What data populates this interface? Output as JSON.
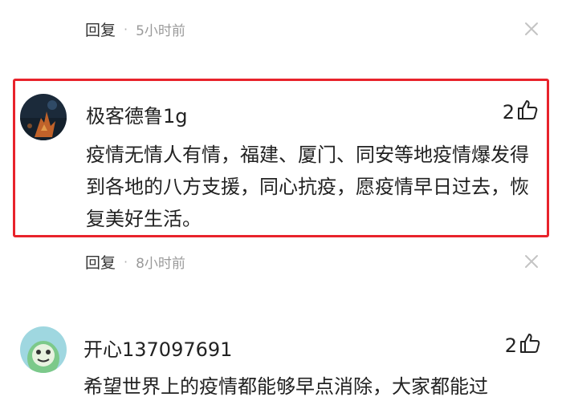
{
  "top_meta": {
    "reply_label": "回复",
    "separator": "·",
    "time": "5小时前"
  },
  "comments": [
    {
      "username": "极客德鲁1g",
      "likes": "2",
      "text": "疫情无情人有情，福建、厦门、同安等地疫情爆发得到各地的八方支援，同心抗疫，愿疫情早日过去，恢复美好生活。",
      "reply_label": "回复",
      "separator": "·",
      "time": "8小时前",
      "highlighted": true,
      "avatar_icon": "dark-scene-avatar-icon"
    },
    {
      "username": "开心137097691",
      "likes": "2",
      "text": "希望世界上的疫情都能够早点消除，大家都能过",
      "highlighted": false,
      "avatar_icon": "green-cartoon-avatar-icon"
    }
  ],
  "colors": {
    "highlight_border": "#e8232b",
    "text": "#222222",
    "meta_time": "#9a9a9a"
  }
}
